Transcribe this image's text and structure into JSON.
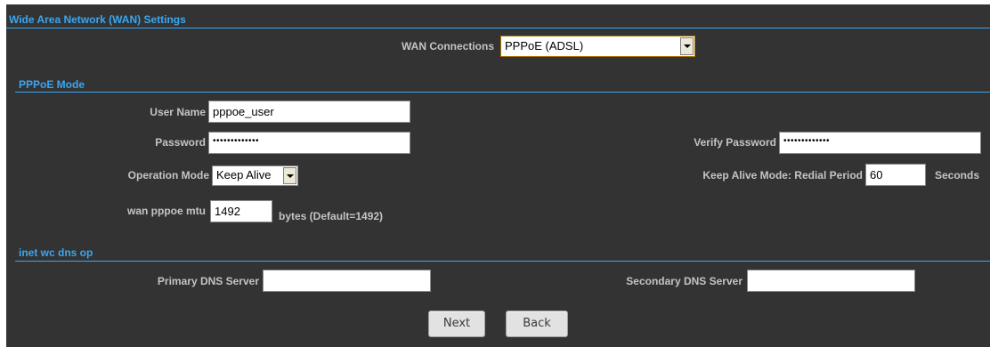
{
  "wan_settings": {
    "title": "Wide Area Network (WAN) Settings",
    "wan_connections_label": "WAN Connections",
    "wan_connections_value": "PPPoE (ADSL)"
  },
  "pppoe": {
    "title": "PPPoE Mode",
    "user_name_label": "User Name",
    "user_name_value": "pppoe_user",
    "password_label": "Password",
    "password_value": "•••••••••••••",
    "verify_password_label": "Verify Password",
    "verify_password_value": "•••••••••••••",
    "operation_mode_label": "Operation Mode",
    "operation_mode_value": "Keep Alive",
    "keep_alive_label": "Keep Alive Mode: Redial Period",
    "redial_period_value": "60",
    "seconds_label": "Seconds",
    "mtu_label": "wan pppoe mtu",
    "mtu_value": "1492",
    "mtu_hint": "bytes (Default=1492)"
  },
  "dns": {
    "title": "inet wc dns op",
    "primary_label": "Primary DNS Server",
    "primary_value": "",
    "secondary_label": "Secondary DNS Server",
    "secondary_value": ""
  },
  "buttons": {
    "next_label": "Next",
    "back_label": "Back"
  },
  "colors": {
    "panel_background": "#333333",
    "section_title": "#3aa6f2",
    "label_text": "#c4c4c4",
    "wan_select_border": "#a8760a"
  }
}
